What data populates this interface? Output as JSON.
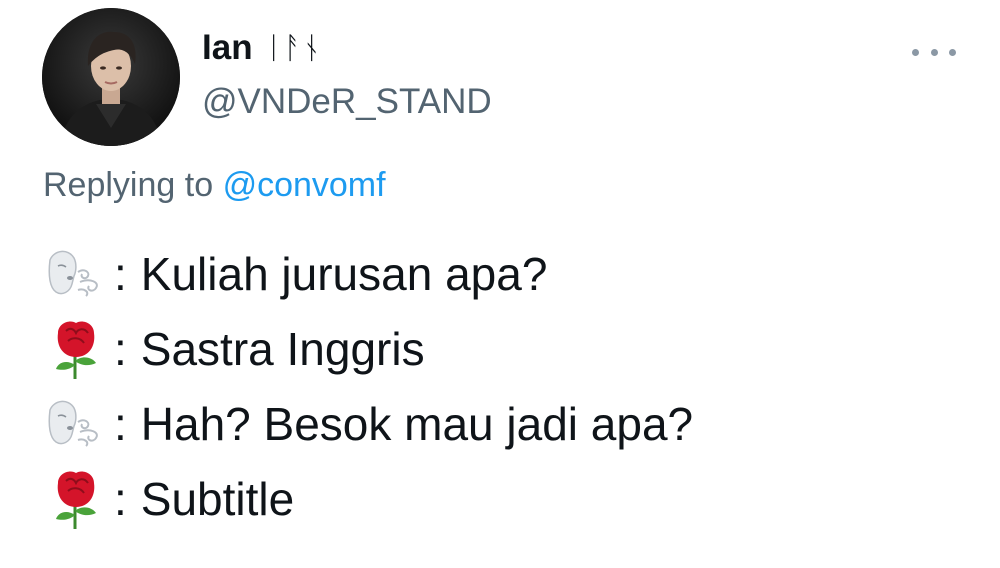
{
  "user": {
    "display_name": "Ian",
    "name_suffix": "ᛁᚨᚾ",
    "handle": "@VNDeR_STAND",
    "avatar_icon": "profile-photo"
  },
  "more_icon": "ellipsis-icon",
  "reply": {
    "prefix": "Replying to",
    "mention": "@convomf"
  },
  "lines": [
    {
      "emoji": "wind-face",
      "sep": ":",
      "text": "Kuliah jurusan apa?"
    },
    {
      "emoji": "rose",
      "sep": ":",
      "text": "Sastra Inggris"
    },
    {
      "emoji": "wind-face",
      "sep": ":",
      "text": "Hah? Besok mau jadi apa?"
    },
    {
      "emoji": "rose",
      "sep": ":",
      "text": "Subtitle"
    }
  ],
  "colors": {
    "text": "#0f1419",
    "secondary": "#536471",
    "link": "#1d9bf0",
    "rose": "#d4142a"
  }
}
